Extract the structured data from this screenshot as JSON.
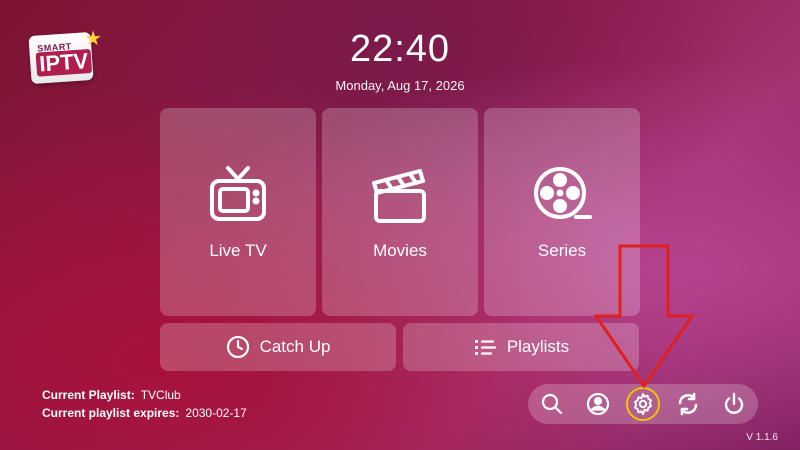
{
  "app": {
    "logo_small": "SMART",
    "logo_big": "IPTV"
  },
  "clock": {
    "time": "22:40",
    "date": "Monday, Aug 17, 2026"
  },
  "tiles": {
    "live_tv": "Live TV",
    "movies": "Movies",
    "series": "Series",
    "catch_up": "Catch Up",
    "playlists": "Playlists"
  },
  "playlist_info": {
    "current_label": "Current Playlist:",
    "current_value": "TVClub",
    "expires_label": "Current playlist expires:",
    "expires_value": "2030-02-17"
  },
  "bottom_bar": {
    "icons": [
      "search-icon",
      "profile-icon",
      "settings-icon",
      "refresh-icon",
      "power-icon"
    ],
    "active": "settings-icon"
  },
  "version": "V 1.1.6",
  "colors": {
    "highlight": "#f2c200",
    "arrow": "#e0201e"
  }
}
